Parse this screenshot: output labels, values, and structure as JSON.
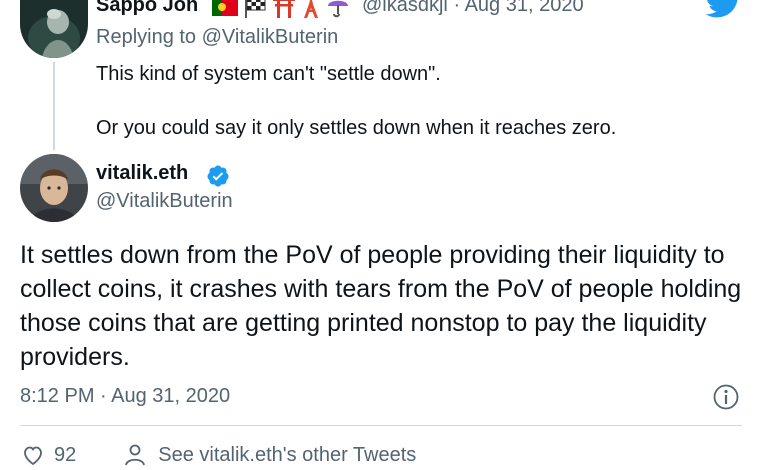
{
  "reply_tweet": {
    "display_name": "Sappo Jon",
    "handle": "@lkasdkjl",
    "separator": "·",
    "date": "Aug 31, 2020",
    "replying_prefix": "Replying to",
    "replying_to": "@VitalikButerin",
    "text_line1": "This kind of system can't \"settle down\".",
    "text_line2": "Or you could say it only settles down when it reaches zero."
  },
  "main_tweet": {
    "display_name": "vitalik.eth",
    "handle": "@VitalikButerin",
    "body": "It settles down from the PoV of people providing their liquidity to collect coins, it crashes with tears from the PoV of people holding those coins that are getting printed nonstop to pay the liquidity providers.",
    "timestamp": "8:12 PM · Aug 31, 2020"
  },
  "actions": {
    "like_count": "92",
    "see_more_label": "See vitalik.eth's other Tweets"
  },
  "colors": {
    "accent": "#1d9bf0",
    "muted_text": "#536471",
    "divider": "#cfd9de"
  },
  "icons": [
    "twitter-bird-icon",
    "verified-badge-icon",
    "info-icon",
    "heart-icon",
    "person-icon"
  ]
}
